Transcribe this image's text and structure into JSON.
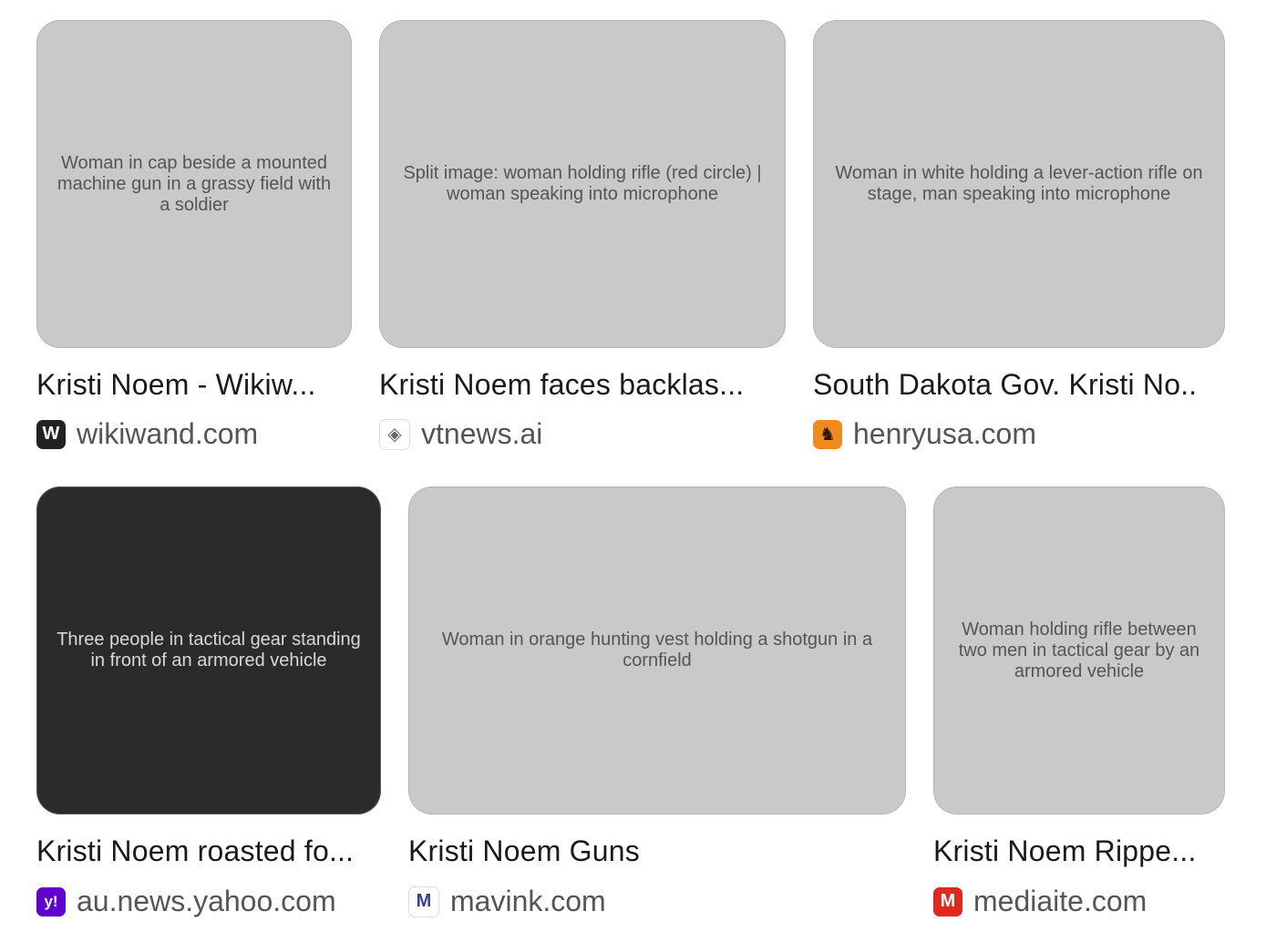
{
  "results": [
    {
      "title": "Kristi Noem - Wikiw...",
      "domain": "wikiwand.com",
      "image_label": "Woman in cap beside a mounted machine gun in a grassy field with a soldier",
      "favicon": {
        "icon": "wikiwand-icon",
        "glyph": "W",
        "bg": "#222222",
        "fg": "#ffffff"
      }
    },
    {
      "title": "Kristi Noem faces backlas...",
      "domain": "vtnews.ai",
      "image_label": "Split image: woman holding rifle (red circle) | woman speaking into microphone",
      "favicon": {
        "icon": "vtnews-icon",
        "glyph": "◈",
        "bg": "#ffffff",
        "fg": "#666666"
      }
    },
    {
      "title": "South Dakota Gov. Kristi No..",
      "domain": "henryusa.com",
      "image_label": "Woman in white holding a lever-action rifle on stage, man speaking into microphone",
      "favicon": {
        "icon": "henry-icon",
        "glyph": "♞",
        "bg": "#f08a1c",
        "fg": "#2a1a0a"
      }
    },
    {
      "title": "Kristi Noem roasted fo...",
      "domain": "au.news.yahoo.com",
      "image_label": "Three people in tactical gear standing in front of an armored vehicle",
      "favicon": {
        "icon": "yahoo-icon",
        "glyph": "y!",
        "bg": "#6001d2",
        "fg": "#ffffff"
      }
    },
    {
      "title": "Kristi Noem Guns",
      "domain": "mavink.com",
      "image_label": "Woman in orange hunting vest holding a shotgun in a cornfield",
      "favicon": {
        "icon": "mavink-icon",
        "glyph": "M",
        "bg": "#ffffff",
        "fg": "#3a3f8f"
      }
    },
    {
      "title": "Kristi Noem Rippe...",
      "domain": "mediaite.com",
      "image_label": "Woman holding rifle between two men in tactical gear by an armored vehicle",
      "favicon": {
        "icon": "mediaite-icon",
        "glyph": "M",
        "bg": "#e0281c",
        "fg": "#ffffff"
      }
    }
  ]
}
